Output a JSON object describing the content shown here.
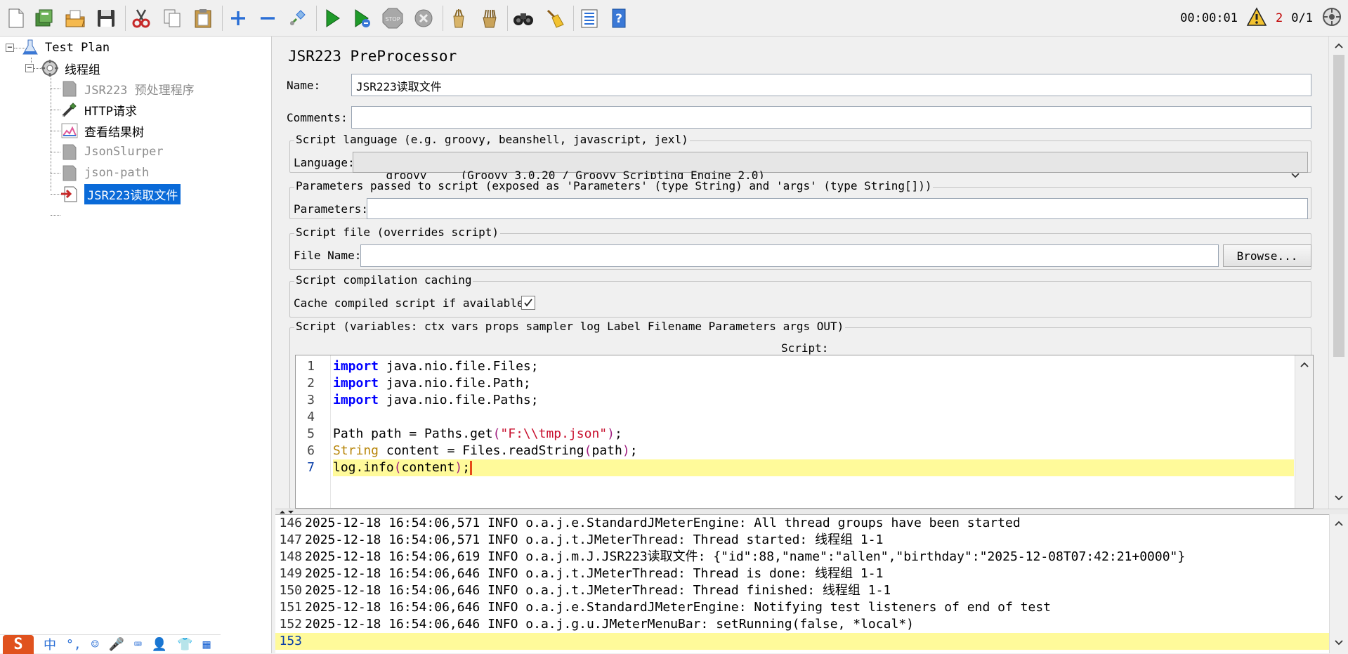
{
  "toolbar": {
    "buttons": [
      "new",
      "templates",
      "open",
      "save",
      "cut",
      "copy",
      "paste",
      "expand",
      "collapse",
      "toggle",
      "start",
      "start-no-pauses",
      "stop",
      "shutdown",
      "clear",
      "clear-all",
      "search",
      "reset-search",
      "function-helper",
      "help"
    ],
    "elapsed_time": "00:00:01",
    "warning_count": "2",
    "threads": "0/1"
  },
  "tree": {
    "items": [
      {
        "label": "Test Plan",
        "icon": "test-plan-icon",
        "state": "normal"
      },
      {
        "label": "线程组",
        "icon": "thread-group-icon",
        "state": "normal"
      },
      {
        "label": "JSR223 预处理程序",
        "icon": "preprocessor-icon",
        "state": "disabled"
      },
      {
        "label": "HTTP请求",
        "icon": "http-sampler-icon",
        "state": "normal"
      },
      {
        "label": "查看结果树",
        "icon": "results-tree-icon",
        "state": "normal"
      },
      {
        "label": "JsonSlurper",
        "icon": "preprocessor-icon",
        "state": "disabled"
      },
      {
        "label": "json-path",
        "icon": "preprocessor-icon",
        "state": "disabled"
      },
      {
        "label": "JSR223读取文件",
        "icon": "preprocessor-active-icon",
        "state": "selected"
      }
    ]
  },
  "ime": {
    "logo": "S",
    "items": [
      "中",
      "°,",
      "☺",
      "🎤",
      "⌨",
      "👤",
      "👕",
      "▦"
    ]
  },
  "panel": {
    "title": "JSR223 PreProcessor",
    "name_label": "Name:",
    "name_value": "JSR223读取文件",
    "comments_label": "Comments:",
    "comments_value": "",
    "script_language_title": "Script language (e.g. groovy, beanshell, javascript, jexl)",
    "language_label": "Language:",
    "language_value": "groovy     (Groovy 3.0.20 / Groovy Scripting Engine 2.0)",
    "parameters_title": "Parameters passed to script (exposed as 'Parameters' (type String) and 'args' (type String[]))",
    "parameters_label": "Parameters:",
    "parameters_value": "",
    "script_file_title": "Script file (overrides script)",
    "file_name_label": "File Name:",
    "file_name_value": "",
    "browse_label": "Browse...",
    "caching_title": "Script compilation caching",
    "cache_label": "Cache compiled script if available:",
    "cache_checked": true,
    "script_title": "Script (variables: ctx vars props sampler log Label Filename Parameters args OUT)",
    "script_caption": "Script:"
  },
  "editor": {
    "line_numbers": [
      "1",
      "2",
      "3",
      "4",
      "5",
      "6",
      "7"
    ],
    "current_line": 7,
    "lines": {
      "l1_kw": "import",
      "l1_rest": " java.nio.file.Files;",
      "l2_kw": "import",
      "l2_rest": " java.nio.file.Path;",
      "l3_kw": "import",
      "l3_rest": " java.nio.file.Paths;",
      "l5_a": "Path path = Paths.get",
      "l5_p1": "(",
      "l5_str": "\"F:\\\\tmp.json\"",
      "l5_p2": ")",
      "l5_end": ";",
      "l6_cls": "String",
      "l6_a": " content = Files.readString",
      "l6_p1": "(",
      "l6_b": "path",
      "l6_p2": ")",
      "l6_end": ";",
      "l7_a": "log.info",
      "l7_p1": "(",
      "l7_b": "content",
      "l7_p2": ")",
      "l7_end": ";"
    }
  },
  "log": {
    "lines": [
      {
        "no": "146",
        "text": "2025-12-18 16:54:06,571 INFO o.a.j.e.StandardJMeterEngine: All thread groups have been started"
      },
      {
        "no": "147",
        "text": "2025-12-18 16:54:06,571 INFO o.a.j.t.JMeterThread: Thread started: 线程组 1-1"
      },
      {
        "no": "148",
        "text": "2025-12-18 16:54:06,619 INFO o.a.j.m.J.JSR223读取文件: {\"id\":88,\"name\":\"allen\",\"birthday\":\"2025-12-08T07:42:21+0000\"}"
      },
      {
        "no": "149",
        "text": "2025-12-18 16:54:06,646 INFO o.a.j.t.JMeterThread: Thread is done: 线程组 1-1"
      },
      {
        "no": "150",
        "text": "2025-12-18 16:54:06,646 INFO o.a.j.t.JMeterThread: Thread finished: 线程组 1-1"
      },
      {
        "no": "151",
        "text": "2025-12-18 16:54:06,646 INFO o.a.j.e.StandardJMeterEngine: Notifying test listeners of end of test"
      },
      {
        "no": "152",
        "text": "2025-12-18 16:54:06,646 INFO o.a.j.g.u.JMeterMenuBar: setRunning(false, *local*)"
      },
      {
        "no": "153",
        "text": ""
      }
    ]
  },
  "colors": {
    "selection": "#0a6ad8",
    "current_line": "#fffa9a",
    "keyword": "#0000ff",
    "string": "#c8102e",
    "warning": "#c00000"
  }
}
